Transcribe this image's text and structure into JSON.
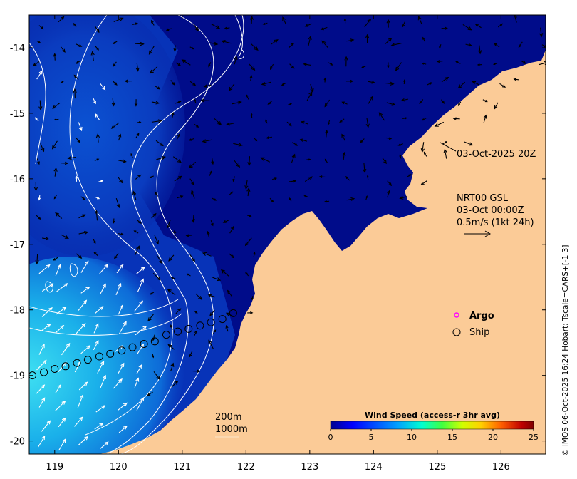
{
  "map": {
    "x_ticks": [
      "119",
      "120",
      "121",
      "122",
      "123",
      "124",
      "125",
      "126"
    ],
    "y_ticks": [
      "-14",
      "-15",
      "-16",
      "-17",
      "-18",
      "-19",
      "-20"
    ],
    "x_range": [
      118.6,
      126.7
    ],
    "y_range": [
      -20.2,
      -13.5
    ],
    "colors": {
      "land": "#fbcb97",
      "ocean_deep": "#000c8a",
      "ocean_mid": "#0a3fc8",
      "ocean_light": "#1aa6e6",
      "ocean_cyan": "#37d6f0",
      "contour": "#ffffff",
      "vector": "#000000"
    }
  },
  "annotations": {
    "timestamp": "03-Oct-2025 20Z",
    "product": "NRT00 GSL",
    "date": "03-Oct 00:00Z",
    "scale": "0.5m/s (1kt 24h)",
    "depth_200": "200m",
    "depth_1000": "1000m"
  },
  "legend": {
    "argo_label": "Argo",
    "argo_color": "#ff00ff",
    "ship_label": "Ship"
  },
  "colorbar": {
    "title": "Wind Speed (access-r 3hr avg)",
    "ticks": [
      "0",
      "5",
      "10",
      "15",
      "20",
      "25"
    ],
    "stops": [
      "#00008f",
      "#0000ff",
      "#00a0ff",
      "#00ffd0",
      "#40ff40",
      "#d0ff00",
      "#ffd000",
      "#ff6000",
      "#c00000",
      "#800000"
    ]
  },
  "credit": "© IMOS 06-Oct-2025 16:24 Hobart; Tscale=CARS+[-1 3]",
  "ship_track": [
    {
      "lon": 118.65,
      "lat": -19.0
    },
    {
      "lon": 118.83,
      "lat": -18.95
    },
    {
      "lon": 119.0,
      "lat": -18.9
    },
    {
      "lon": 119.17,
      "lat": -18.86
    },
    {
      "lon": 119.35,
      "lat": -18.81
    },
    {
      "lon": 119.52,
      "lat": -18.76
    },
    {
      "lon": 119.7,
      "lat": -18.71
    },
    {
      "lon": 119.87,
      "lat": -18.67
    },
    {
      "lon": 120.05,
      "lat": -18.62
    },
    {
      "lon": 120.22,
      "lat": -18.57
    },
    {
      "lon": 120.4,
      "lat": -18.52
    },
    {
      "lon": 120.57,
      "lat": -18.48
    },
    {
      "lon": 120.75,
      "lat": -18.38
    },
    {
      "lon": 120.93,
      "lat": -18.33
    },
    {
      "lon": 121.1,
      "lat": -18.29
    },
    {
      "lon": 121.28,
      "lat": -18.24
    },
    {
      "lon": 121.45,
      "lat": -18.19
    },
    {
      "lon": 121.63,
      "lat": -18.14
    },
    {
      "lon": 121.8,
      "lat": -18.05
    }
  ]
}
